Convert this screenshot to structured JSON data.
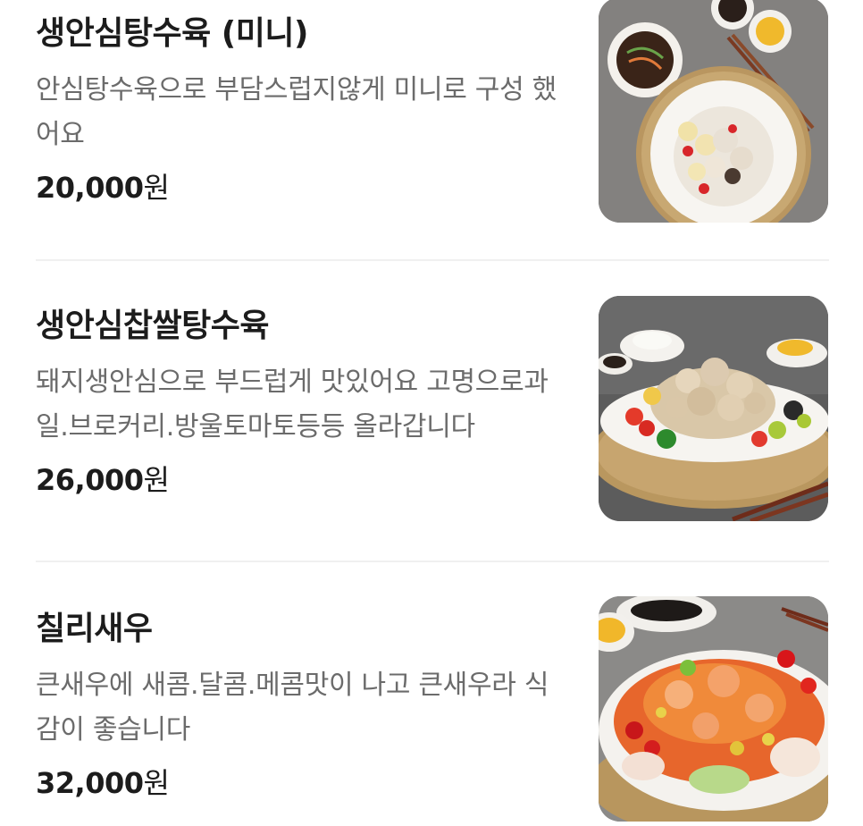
{
  "menu": {
    "items": [
      {
        "name": "생안심탕수육 (미니)",
        "description": "안심탕수육으로 부담스럽지않게 미니로 구성 했어요",
        "price": "20,000",
        "currency": "원",
        "image_icon": "food-photo-icon"
      },
      {
        "name": "생안심찹쌀탕수육",
        "description": "돼지생안심으로 부드럽게 맛있어요 고명으로과일.브로커리.방울토마토등등 올라갑니다",
        "price": "26,000",
        "currency": "원",
        "image_icon": "food-photo-icon"
      },
      {
        "name": "칠리새우",
        "description": "큰새우에 새콤.달콤.메콤맛이 나고 큰새우라 식감이 좋습니다",
        "price": "32,000",
        "currency": "원",
        "image_icon": "food-photo-icon"
      }
    ]
  },
  "colors": {
    "title": "#1c1c1c",
    "description": "#6b6b6b",
    "divider": "#f0f0f0",
    "background": "#ffffff"
  }
}
